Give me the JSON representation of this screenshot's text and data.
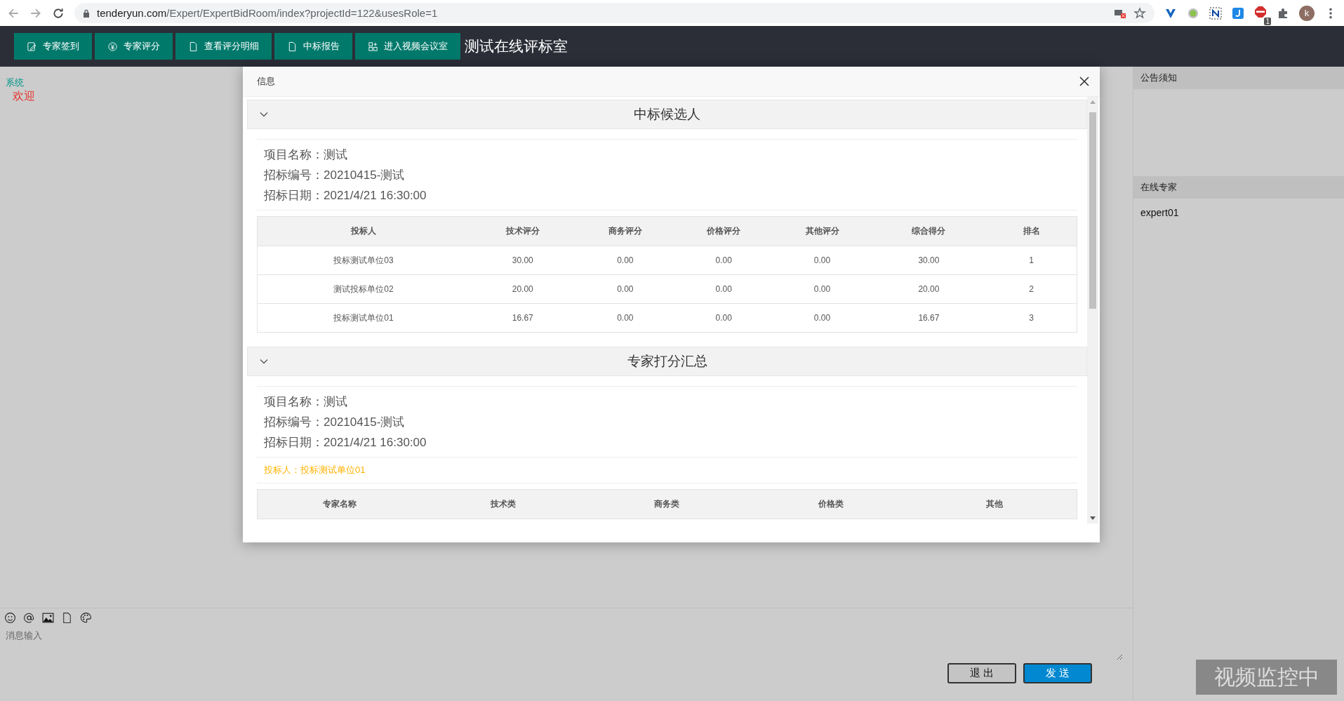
{
  "browser": {
    "url_host": "tenderyun.com",
    "url_path": "/Expert/ExpertBidRoom/index?projectId=122&usesRole=1",
    "extension_badge": "1",
    "profile_initial": "k"
  },
  "toolbar": {
    "buttons": [
      {
        "label": "专家签到"
      },
      {
        "label": "专家评分"
      },
      {
        "label": "查看评分明细"
      },
      {
        "label": "中标报告"
      },
      {
        "label": "进入视频会议室"
      }
    ],
    "title": "测试在线评标室"
  },
  "messages": [
    {
      "kind": "system",
      "text": "系统"
    },
    {
      "kind": "welcome",
      "text": "欢迎"
    }
  ],
  "chat_input": {
    "placeholder": "消息输入"
  },
  "actions": [
    {
      "label": "退 出",
      "kind": "secondary"
    },
    {
      "label": "发 送",
      "kind": "primary"
    }
  ],
  "right_panel": {
    "notice_title": "公告须知",
    "online_title": "在线专家",
    "experts": [
      "expert01"
    ]
  },
  "monitor_badge": "视频监控中",
  "dialog": {
    "title": "信息",
    "sections": [
      {
        "title": "中标候选人",
        "expanded": true,
        "info": [
          "项目名称：测试",
          "招标编号：20210415-测试",
          "招标日期：2021/4/21 16:30:00"
        ],
        "table": {
          "columns": [
            "投标人",
            "技术评分",
            "商务评分",
            "价格评分",
            "其他评分",
            "综合得分",
            "排名"
          ],
          "rows": [
            [
              "投标测试单位03",
              "30.00",
              "0.00",
              "0.00",
              "0.00",
              "30.00",
              "1"
            ],
            [
              "测试投标单位02",
              "20.00",
              "0.00",
              "0.00",
              "0.00",
              "20.00",
              "2"
            ],
            [
              "投标测试单位01",
              "16.67",
              "0.00",
              "0.00",
              "0.00",
              "16.67",
              "3"
            ]
          ]
        }
      },
      {
        "title": "专家打分汇总",
        "expanded": true,
        "info": [
          "项目名称：测试",
          "招标编号：20210415-测试",
          "招标日期：2021/4/21 16:30:00"
        ],
        "bidder": "投标人：投标测试单位01",
        "table": {
          "columns": [
            "专家名称",
            "技术类",
            "商务类",
            "价格类",
            "其他"
          ]
        }
      }
    ]
  }
}
